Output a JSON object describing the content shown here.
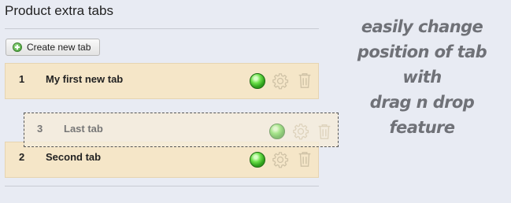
{
  "header": {
    "title": "Product extra tabs"
  },
  "toolbar": {
    "create_label": "Create new tab"
  },
  "tabs": [
    {
      "position": "1",
      "name": "My first new tab",
      "active": true
    },
    {
      "position": "2",
      "name": "Second tab",
      "active": true
    }
  ],
  "dragging": {
    "position": "3",
    "name": "Last tab",
    "active": true
  },
  "caption": {
    "lines": [
      "easily change",
      "position of tab with",
      "drag n drop feature"
    ]
  },
  "colors": {
    "row_background": "#f5e6c8",
    "page_background": "#e8ebf3",
    "status_active": "#3fbf24",
    "caption_text": "#6f7177"
  },
  "icons": {
    "create": "plus-circle-icon",
    "status": "green-status-icon",
    "edit": "gear-icon",
    "delete": "trash-icon"
  }
}
